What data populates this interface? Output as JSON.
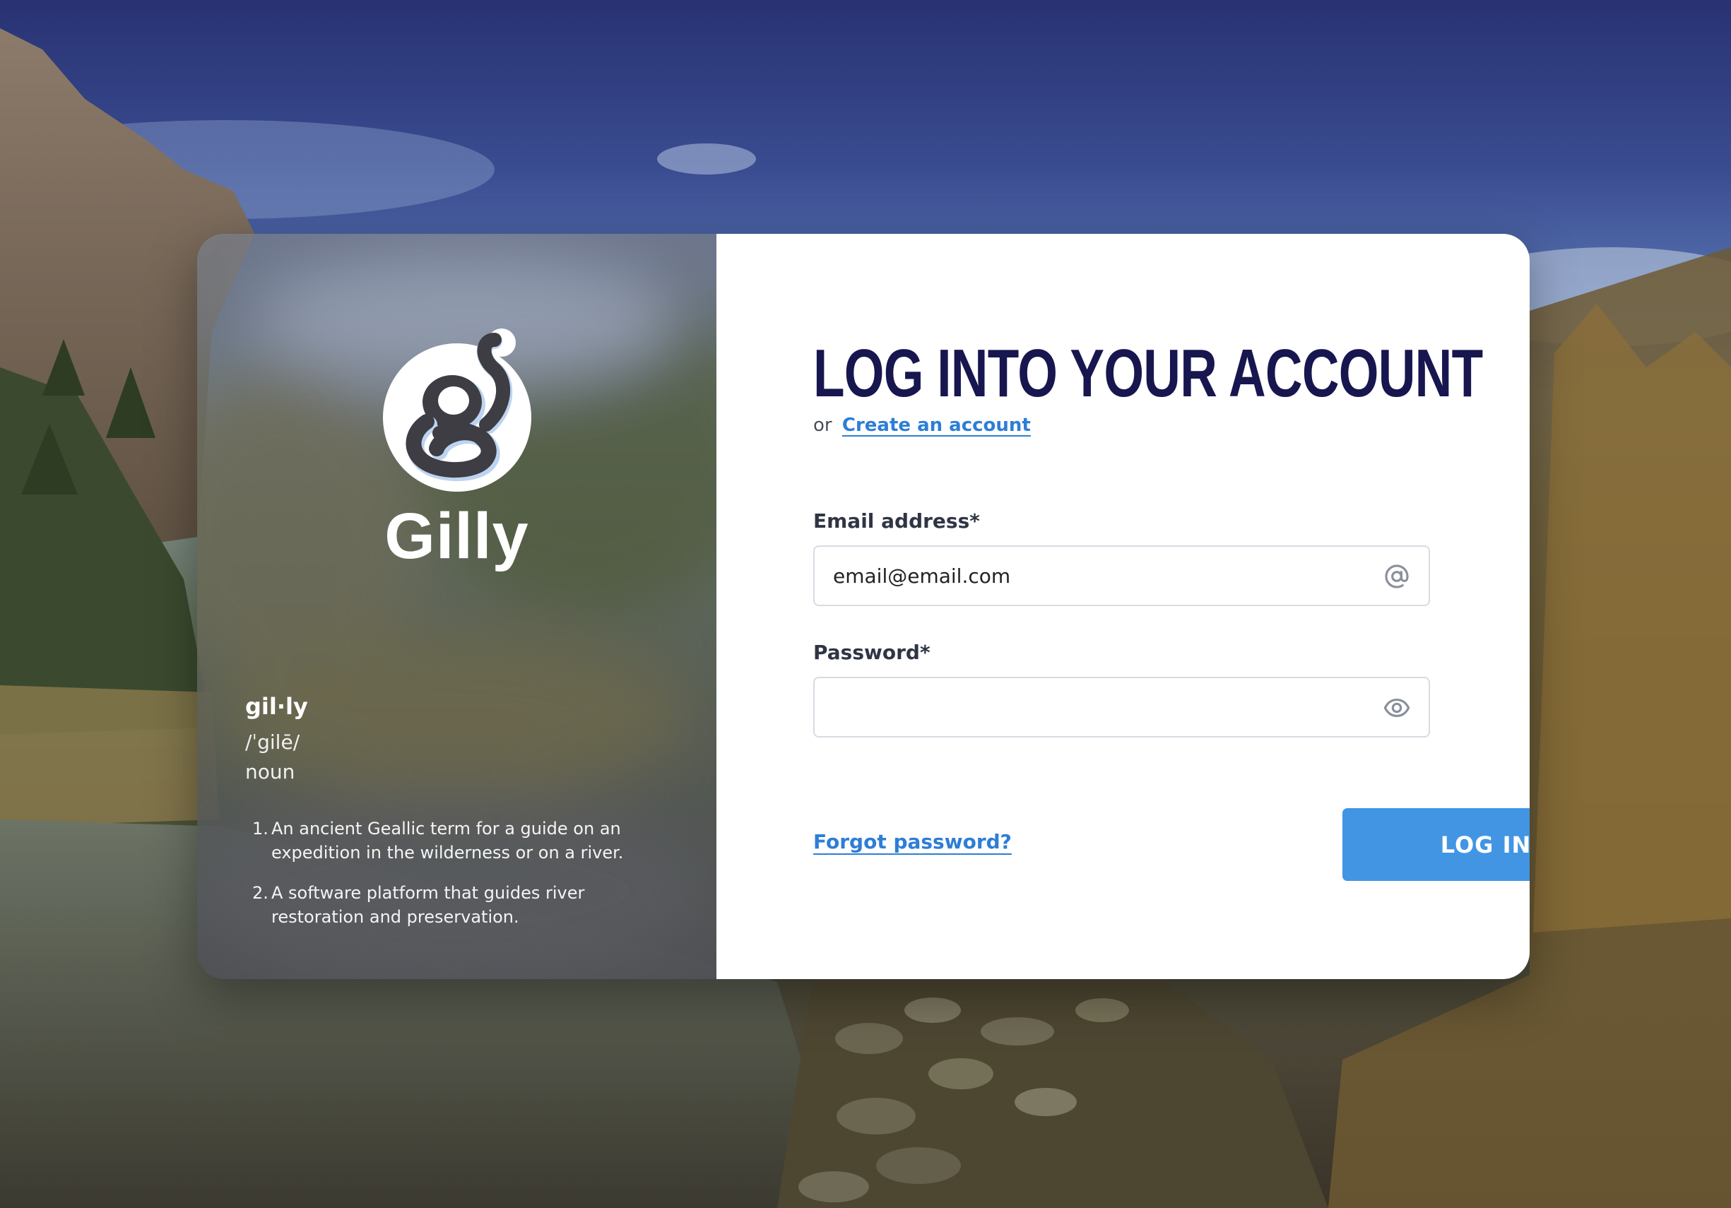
{
  "brand": {
    "name": "Gilly",
    "accent_color": "#4295e3",
    "title_color": "#17164f"
  },
  "definition": {
    "word": "gil·ly",
    "phonetic": "/ˈgilē/",
    "part_of_speech": "noun",
    "items": [
      {
        "num": "1.",
        "text": "An ancient Geallic term for a guide on an expedition in the wilderness or on a river."
      },
      {
        "num": "2.",
        "text": "A software platform that guides river restoration and preservation."
      }
    ]
  },
  "login": {
    "title": "LOG INTO YOUR ACCOUNT",
    "or_text": "or",
    "create_account_link": "Create an account",
    "email": {
      "label": "Email address*",
      "value": "email@email.com",
      "placeholder": "",
      "icon": "at-icon"
    },
    "password": {
      "label": "Password*",
      "value": "",
      "icon": "eye-icon"
    },
    "forgot_password_link": "Forgot password?",
    "submit_label": "LOG IN"
  }
}
